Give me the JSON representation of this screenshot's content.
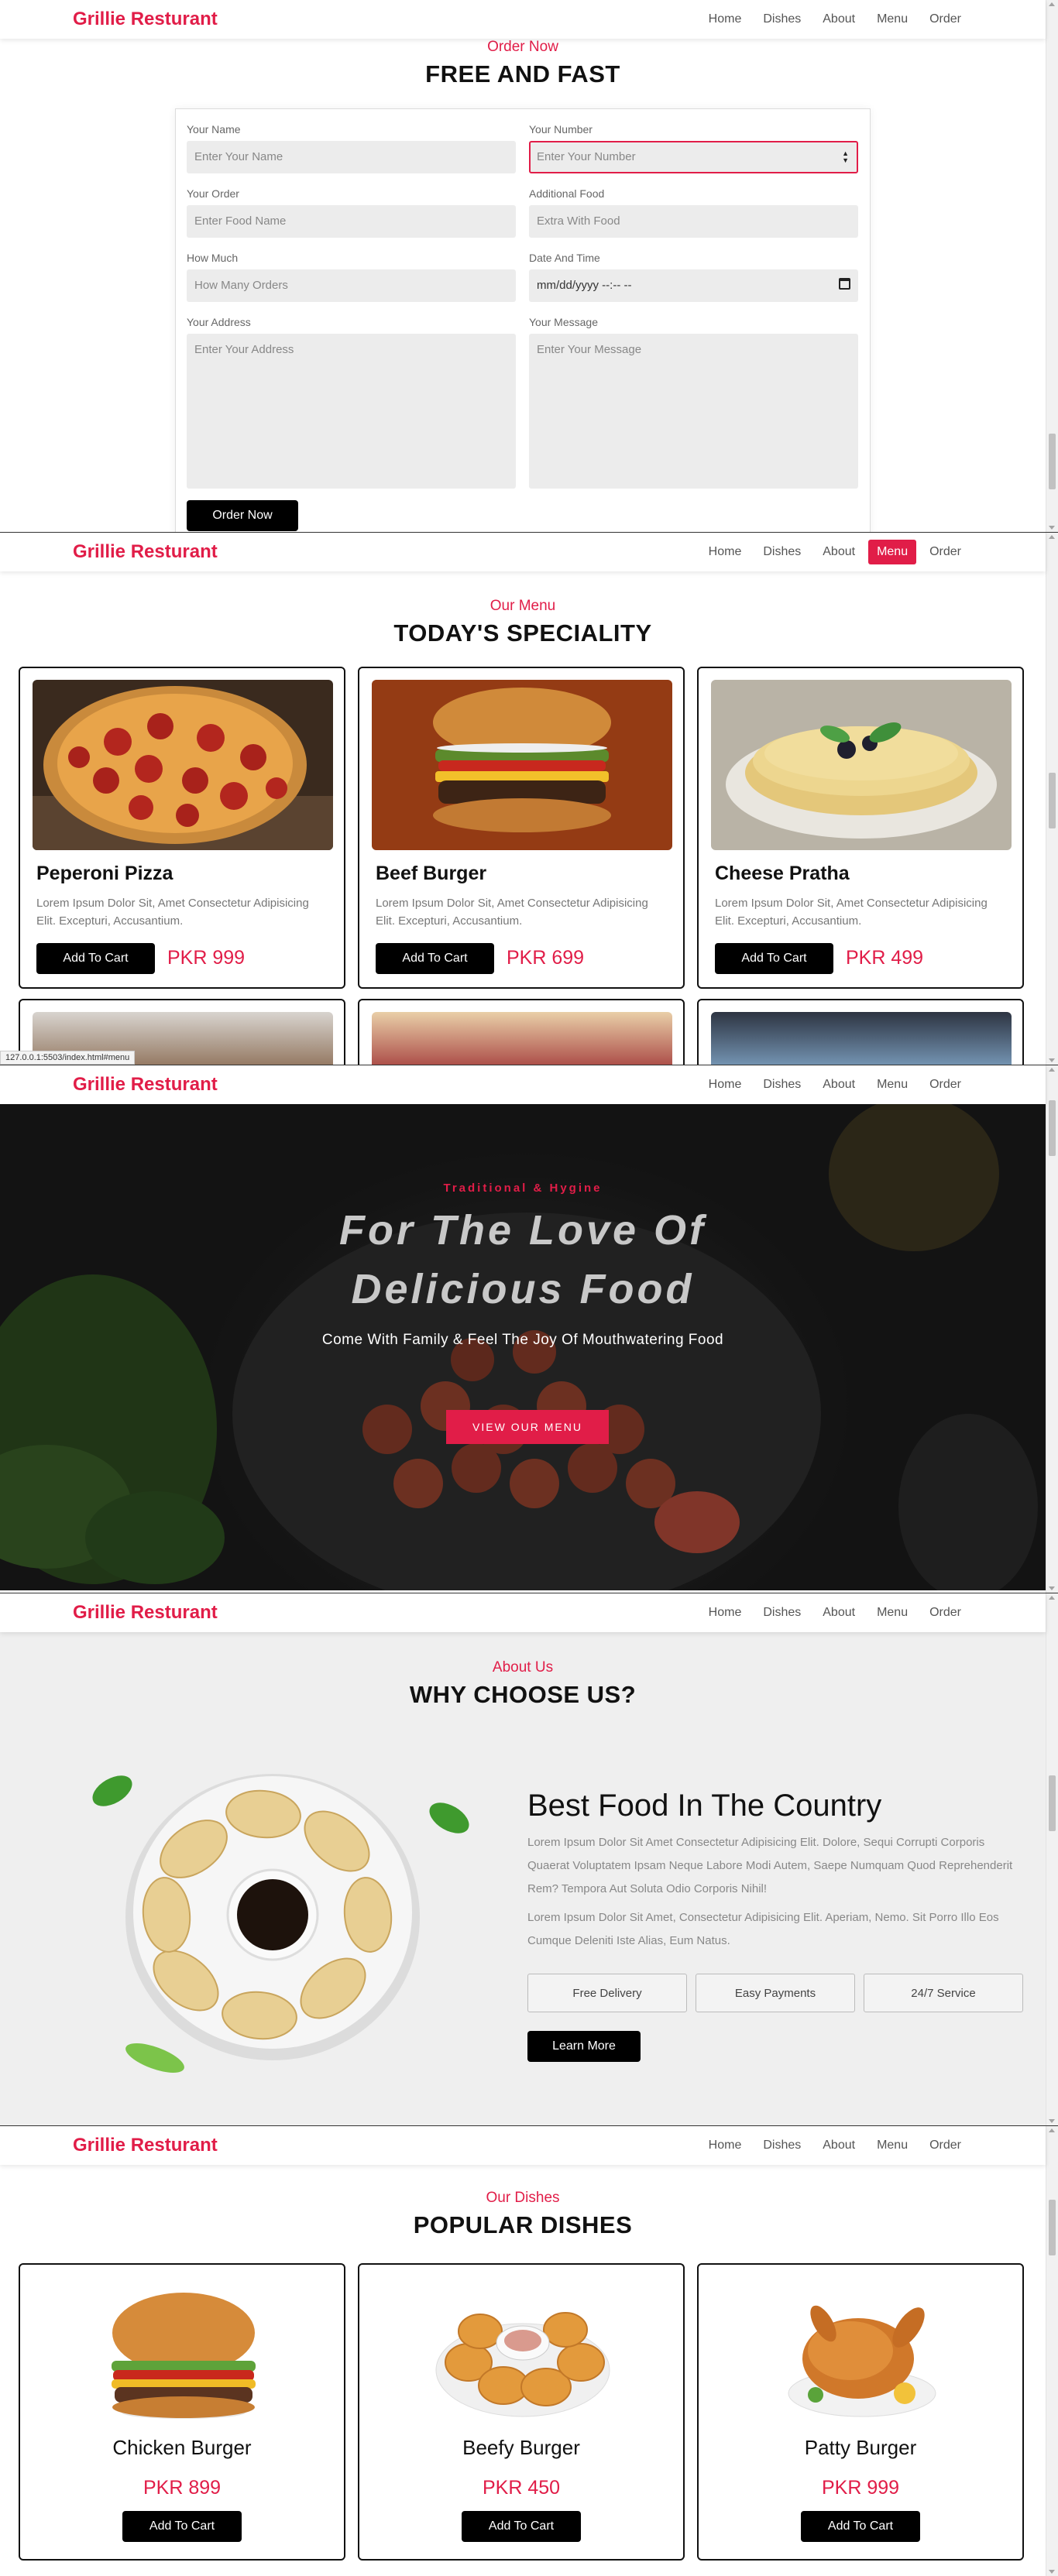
{
  "nav": {
    "brand": "Grillie Resturant",
    "links": [
      "Home",
      "Dishes",
      "About",
      "Menu",
      "Order"
    ]
  },
  "order": {
    "kicker": "Order Now",
    "heading": "FREE AND FAST",
    "fields": {
      "name": {
        "label": "Your Name",
        "placeholder": "Enter Your Name"
      },
      "number": {
        "label": "Your Number",
        "placeholder": "Enter Your Number"
      },
      "order": {
        "label": "Your Order",
        "placeholder": "Enter Food Name"
      },
      "additional": {
        "label": "Additional Food",
        "placeholder": "Extra With Food"
      },
      "howmuch": {
        "label": "How Much",
        "placeholder": "How Many Orders"
      },
      "datetime": {
        "label": "Date And Time",
        "placeholder": "mm/dd/yyyy --:-- --"
      },
      "address": {
        "label": "Your Address",
        "placeholder": "Enter Your Address"
      },
      "message": {
        "label": "Your Message",
        "placeholder": "Enter Your Message"
      }
    },
    "submit": "Order Now"
  },
  "menu": {
    "kicker": "Our Menu",
    "heading": "TODAY'S SPECIALITY",
    "items": [
      {
        "title": "Peperoni Pizza",
        "desc": "Lorem Ipsum Dolor Sit, Amet Consectetur Adipisicing Elit. Excepturi, Accusantium.",
        "price": "PKR 999",
        "button": "Add To Cart"
      },
      {
        "title": "Beef Burger",
        "desc": "Lorem Ipsum Dolor Sit, Amet Consectetur Adipisicing Elit. Excepturi, Accusantium.",
        "price": "PKR 699",
        "button": "Add To Cart"
      },
      {
        "title": "Cheese Pratha",
        "desc": "Lorem Ipsum Dolor Sit, Amet Consectetur Adipisicing Elit. Excepturi, Accusantium.",
        "price": "PKR 499",
        "button": "Add To Cart"
      }
    ],
    "status_url": "127.0.0.1:5503/index.html#menu"
  },
  "hero": {
    "subtitle": "Traditional & Hygine",
    "title_line1": "For The Love Of",
    "title_line2": "Delicious Food",
    "text": "Come With Family & Feel The Joy Of Mouthwatering Food",
    "button": "VIEW OUR MENU"
  },
  "about": {
    "kicker": "About Us",
    "heading": "WHY CHOOSE US?",
    "title": "Best Food In The Country",
    "para1": "Lorem Ipsum Dolor Sit Amet Consectetur Adipisicing Elit. Dolore, Sequi Corrupti Corporis Quaerat Voluptatem Ipsam Neque Labore Modi Autem, Saepe Numquam Quod Reprehenderit Rem? Tempora Aut Soluta Odio Corporis Nihil!",
    "para2": "Lorem Ipsum Dolor Sit Amet, Consectetur Adipisicing Elit. Aperiam, Nemo. Sit Porro Illo Eos Cumque Deleniti Iste Alias, Eum Natus.",
    "tags": [
      "Free Delivery",
      "Easy Payments",
      "24/7 Service"
    ],
    "button": "Learn More"
  },
  "dishes": {
    "kicker": "Our Dishes",
    "heading": "POPULAR DISHES",
    "items": [
      {
        "title": "Chicken Burger",
        "price": "PKR 899",
        "button": "Add To Cart"
      },
      {
        "title": "Beefy Burger",
        "price": "PKR 450",
        "button": "Add To Cart"
      },
      {
        "title": "Patty Burger",
        "price": "PKR 999",
        "button": "Add To Cart"
      }
    ]
  },
  "colors": {
    "brand": "#e11d48",
    "button": "#000000",
    "about_bg": "#efefef"
  }
}
